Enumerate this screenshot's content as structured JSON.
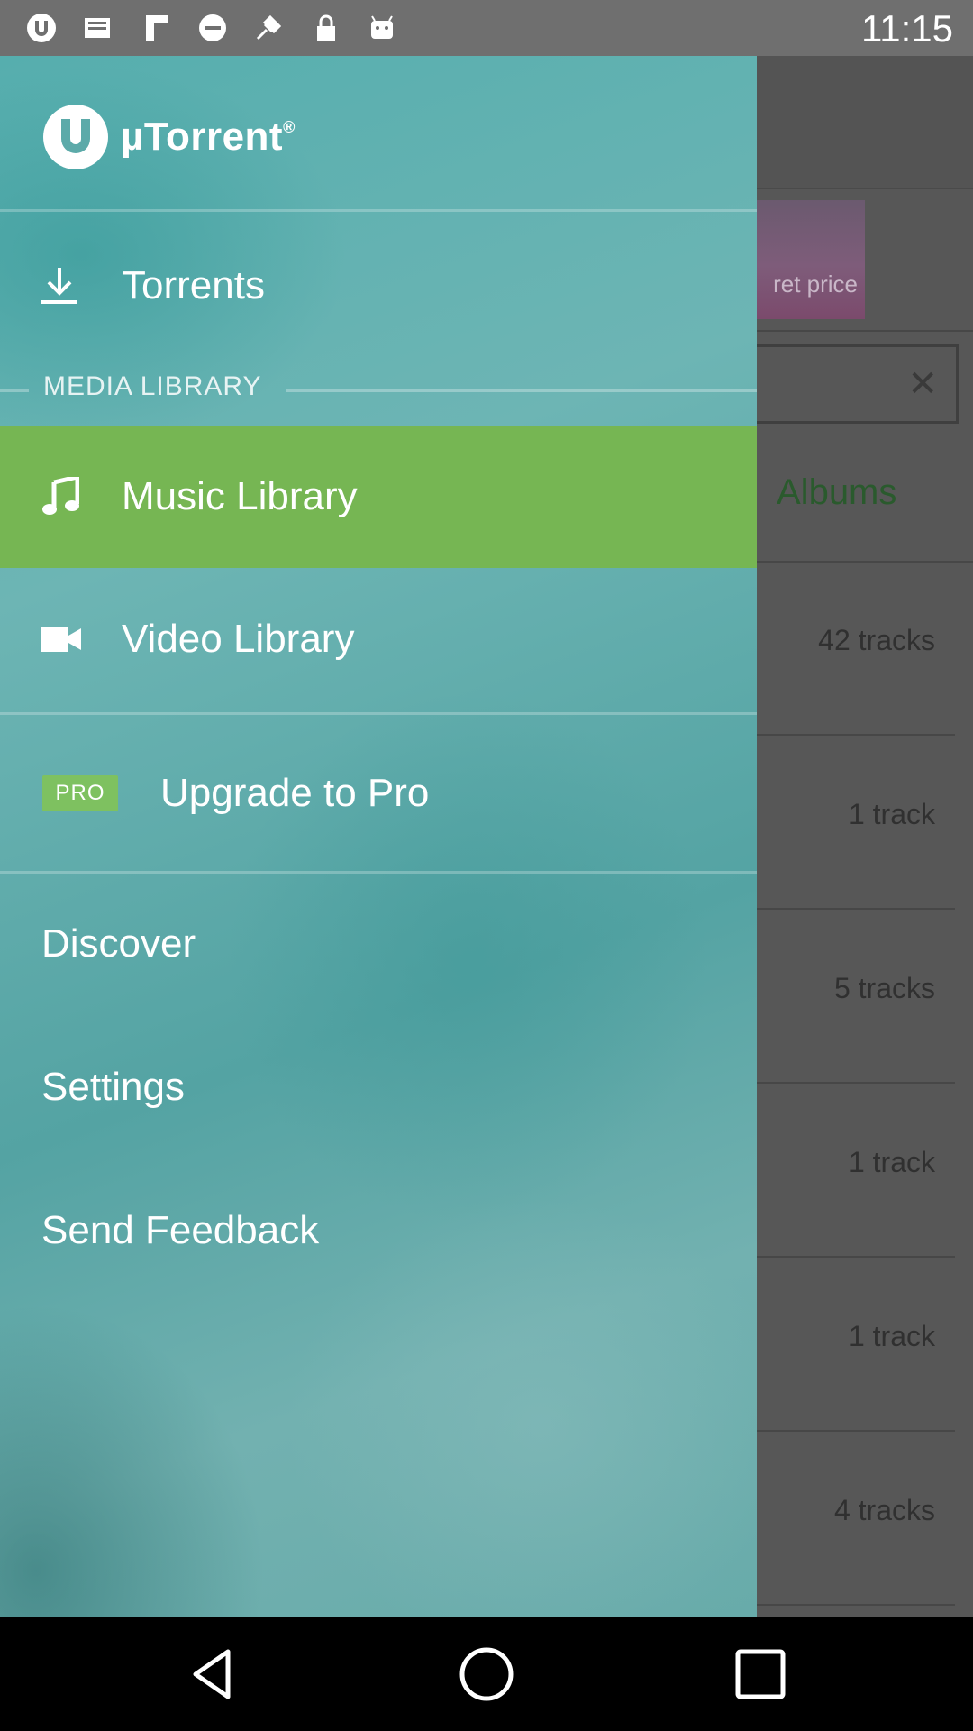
{
  "status_bar": {
    "time": "11:15",
    "icons": [
      "utorrent-icon",
      "inbox-icon",
      "flipboard-icon",
      "do-not-disturb-icon",
      "fake-gps-icon",
      "lock-icon",
      "android-icon"
    ]
  },
  "background_app": {
    "ad_text": "ret price",
    "tab_albums": "Albums",
    "track_counts": [
      "42 tracks",
      "1 track",
      "5 tracks",
      "1 track",
      "1 track",
      "4 tracks"
    ]
  },
  "drawer": {
    "brand": "µTorrent",
    "brand_mark": "®",
    "items": {
      "torrents": "Torrents",
      "section_media": "MEDIA LIBRARY",
      "music": "Music Library",
      "video": "Video Library",
      "pro_badge": "PRO",
      "upgrade": "Upgrade to Pro",
      "discover": "Discover",
      "settings": "Settings",
      "feedback": "Send Feedback"
    }
  },
  "colors": {
    "active_item": "#76b653",
    "drawer_teal": "#5ea9a8",
    "pro_badge": "#7ec160"
  },
  "nav": [
    "back-icon",
    "home-icon",
    "recents-icon"
  ]
}
